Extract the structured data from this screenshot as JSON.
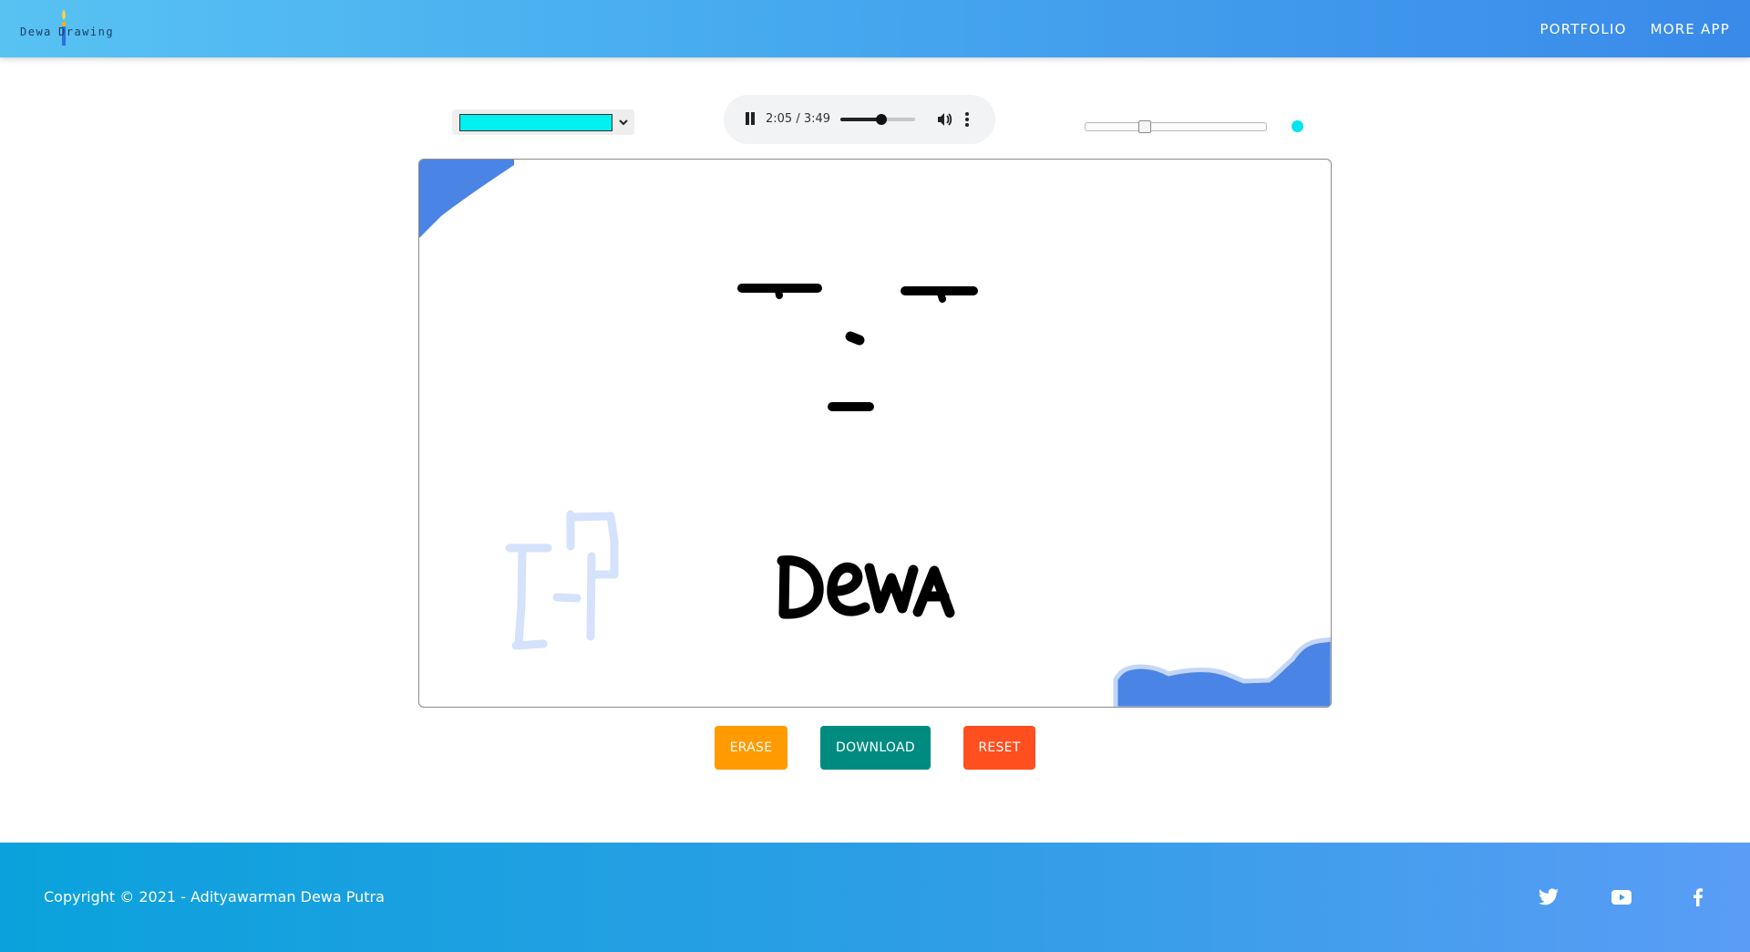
{
  "header": {
    "logo": {
      "word_left": "Dewa",
      "word_right": "Drawing"
    },
    "nav": [
      {
        "label": "PORTFOLIO"
      },
      {
        "label": "MORE APP"
      }
    ]
  },
  "toolbar": {
    "color_picker": {
      "selected_color": "#00f0f0"
    },
    "audio_player": {
      "time_display": "2:05 / 3:49",
      "progress": 0.546,
      "state": "playing"
    },
    "brush_size": {
      "value_fraction": 0.33
    },
    "brush_preview_color": "#00e5ef"
  },
  "canvas": {
    "drawn_text": "DEWA"
  },
  "buttons": {
    "erase": "ERASE",
    "download": "DOWNLOAD",
    "reset": "RESET"
  },
  "footer": {
    "copyright": "Copyright © 2021 - Adityawarman Dewa Putra",
    "social_icons": [
      "twitter-icon",
      "youtube-icon",
      "facebook-icon"
    ]
  },
  "colors": {
    "header_gradient_start": "#58c2f3",
    "header_gradient_end": "#3a8ae9",
    "erase": "#ff9a00",
    "download": "#008b80",
    "reset": "#ff4f1f",
    "stroke_blue": "#4a84e4",
    "stroke_light": "#d4e2fb"
  }
}
